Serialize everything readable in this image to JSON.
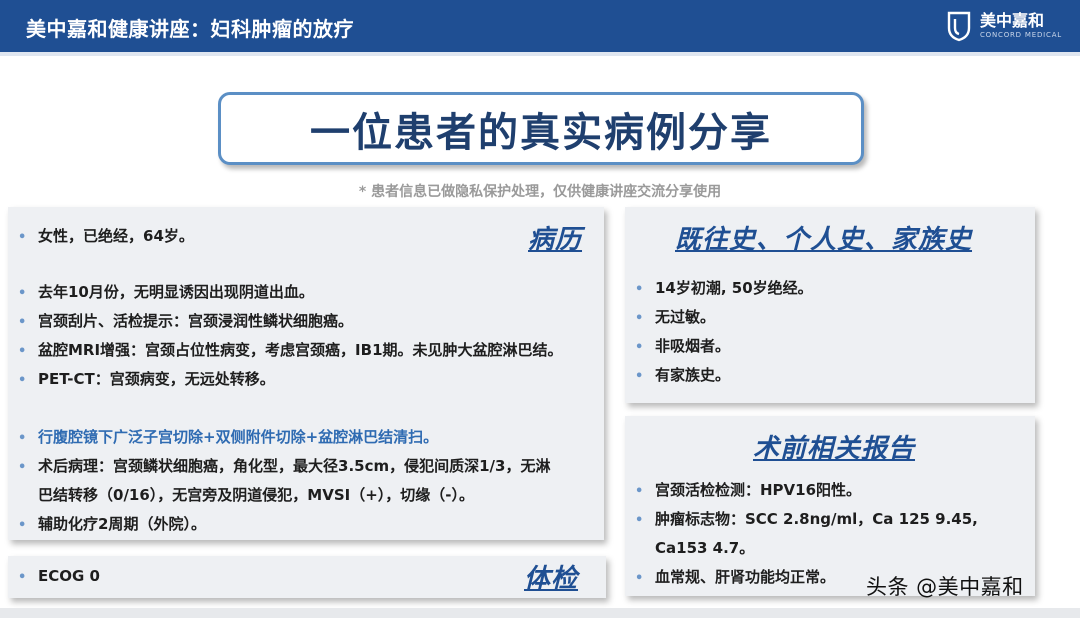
{
  "header": {
    "title": "美中嘉和健康讲座：妇科肿瘤的放疗",
    "logo_cn": "美中嘉和",
    "logo_en": "CONCORD MEDICAL"
  },
  "main_title": "一位患者的真实病例分享",
  "notice": "* 患者信息已做隐私保护处理，仅供健康讲座交流分享使用",
  "history": {
    "title": "病历",
    "l1": "女性，已绝经，64岁。",
    "l2": "去年10月份，无明显诱因出现阴道出血。",
    "l3": "宫颈刮片、活检提示：宫颈浸润性鳞状细胞癌。",
    "l4": "盆腔MRI增强：宫颈占位性病变，考虑宫颈癌，IB1期。未见肿大盆腔淋巴结。",
    "l5": "PET-CT：宫颈病变，无远处转移。",
    "l6": "行腹腔镜下广泛子宫切除+双侧附件切除+盆腔淋巴结清扫。",
    "l7a": "术后病理：宫颈鳞状细胞癌，角化型，最大径3.5cm，侵犯间质深1/3，无淋",
    "l7b": "巴结转移（0/16），无宫旁及阴道侵犯，MVSI（+），切缘（-）。",
    "l8": "辅助化疗2周期（外院）。"
  },
  "exam": {
    "title": "体检",
    "l1": "ECOG 0"
  },
  "past": {
    "title": "既往史、个人史、家族史",
    "l1": "14岁初潮, 50岁绝经。",
    "l2": "无过敏。",
    "l3": "非吸烟者。",
    "l4": "有家族史。"
  },
  "preop": {
    "title": "术前相关报告",
    "l1": "宫颈活检检测：HPV16阳性。",
    "l2a": "肿瘤标志物：SCC 2.8ng/ml，Ca 125 9.45,",
    "l2b": "Ca153 4.7。",
    "l3": "血常规、肝肾功能均正常。"
  },
  "bullet": "•",
  "watermark": "头条 @美中嘉和",
  "colors": {
    "header": "#1f4f93",
    "accent": "#1f4f93",
    "highlight": "#2f6bb2",
    "card": "#eef0f3"
  }
}
